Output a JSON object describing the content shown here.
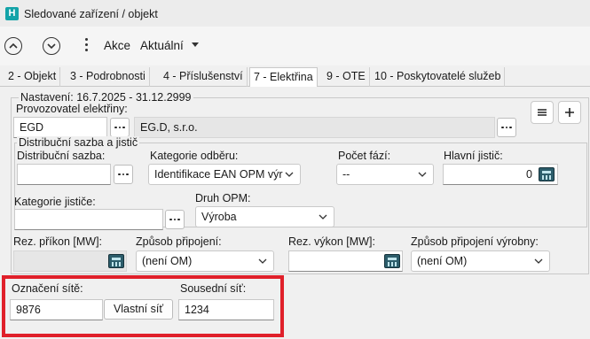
{
  "window": {
    "app_icon_letter": "H",
    "title": "Sledované zařízení / objekt"
  },
  "toolbar": {
    "actions_label": "Akce",
    "view_label": "Aktuální"
  },
  "tabs": [
    {
      "label": "2 - Objekt",
      "active": false
    },
    {
      "label": "3 - Podrobnosti",
      "active": false
    },
    {
      "label": "4 - Příslušenství",
      "active": false
    },
    {
      "label": "7 - Elektřina",
      "active": true
    },
    {
      "label": "9 - OTE",
      "active": false
    },
    {
      "label": "10 - Poskytovatelé služeb",
      "active": false
    }
  ],
  "settings_group": {
    "legend": "Nastavení: 16.7.2025 - 31.12.2999"
  },
  "provider": {
    "label": "Provozovatel elektřiny:",
    "code": "EGD",
    "name": "EG.D, s.r.o."
  },
  "tariff_group": {
    "legend": "Distribuční sazba a jistič"
  },
  "fields": {
    "distribution_rate": {
      "label": "Distribuční sazba:",
      "value": ""
    },
    "consumption_category": {
      "label": "Kategorie odběru:",
      "value": "Identifikace EAN OPM výr"
    },
    "phase_count": {
      "label": "Počet fází:",
      "value": "--"
    },
    "main_breaker": {
      "label": "Hlavní jistič:",
      "value": "0"
    },
    "breaker_category": {
      "label": "Kategorie jističe:",
      "value": ""
    },
    "opm_type": {
      "label": "Druh OPM:",
      "value": "Výroba"
    },
    "reserved_input": {
      "label": "Rez. příkon [MW]:",
      "value": ""
    },
    "connection_method": {
      "label": "Způsob připojení:",
      "value": "(není OM)"
    },
    "reserved_output": {
      "label": "Rez. výkon [MW]:",
      "value": ""
    },
    "production_connection_method": {
      "label": "Způsob připojení výrobny:",
      "value": "(není OM)"
    },
    "network_designation": {
      "label": "Označení sítě:",
      "value": "9876"
    },
    "own_network_button": "Vlastní síť",
    "neighbor_network": {
      "label": "Sousední síť:",
      "value": "1234"
    }
  },
  "icons": {
    "app": "app-logo-icon",
    "back": "chevron-up-circle-icon",
    "forward": "chevron-down-circle-icon",
    "menu": "kebab-menu-icon",
    "list": "list-icon",
    "add": "plus-icon",
    "calculator": "calculator-icon"
  },
  "colors": {
    "app_icon": "#13a3a8",
    "highlight_border": "#e0202a",
    "calculator": "#2c5d6b"
  }
}
